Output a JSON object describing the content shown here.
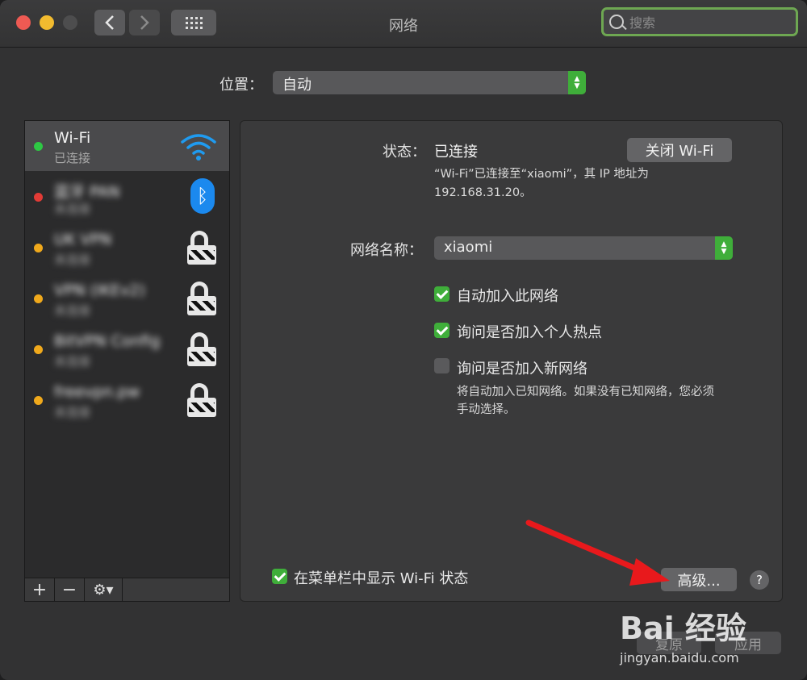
{
  "window": {
    "title": "网络"
  },
  "search": {
    "placeholder": "搜索"
  },
  "location": {
    "label": "位置：",
    "value": "自动"
  },
  "sidebar": {
    "items": [
      {
        "name": "Wi-Fi",
        "status": "已连接",
        "status_color": "#2ec844",
        "icon": "wifi-icon"
      },
      {
        "name": "蓝牙 PAN",
        "status": "未连接",
        "status_color": "#e23b36",
        "icon": "bluetooth-icon"
      },
      {
        "name": "UK VPN",
        "status": "未连接",
        "status_color": "#f0a91c",
        "icon": "lock-icon"
      },
      {
        "name": "VPN (IKEv2)",
        "status": "未连接",
        "status_color": "#f0a91c",
        "icon": "lock-icon"
      },
      {
        "name": "BitVPN Config",
        "status": "未连接",
        "status_color": "#f0a91c",
        "icon": "lock-icon"
      },
      {
        "name": "freevpn.pw",
        "status": "未连接",
        "status_color": "#f0a91c",
        "icon": "lock-icon"
      }
    ]
  },
  "detail": {
    "status_label": "状态：",
    "status_value": "已连接",
    "turn_off_button": "关闭 Wi-Fi",
    "status_desc_line1": "“Wi-Fi”已连接至“xiaomi”，其 IP 地址为",
    "status_desc_line2": "192.168.31.20。",
    "network_name_label": "网络名称：",
    "network_name_value": "xiaomi",
    "auto_join_label": "自动加入此网络",
    "ask_hotspot_label": "询问是否加入个人热点",
    "ask_new_label": "询问是否加入新网络",
    "ask_new_desc_line1": "将自动加入已知网络。如果没有已知网络，您必须",
    "ask_new_desc_line2": "手动选择。",
    "menubar_label": "在菜单栏中显示 Wi-Fi 状态",
    "advanced_button": "高级...",
    "help_button": "?"
  },
  "footer": {
    "revert": "复原",
    "apply": "应用"
  },
  "watermark": {
    "logo": "Bai 经验",
    "url": "jingyan.baidu.com"
  },
  "colors": {
    "accent": "#3fae3a",
    "annotation_arrow": "#e8191c"
  }
}
